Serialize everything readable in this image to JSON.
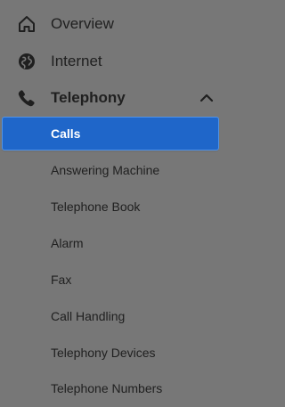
{
  "nav": {
    "top_items": [
      {
        "label": "Overview",
        "icon": "home-icon"
      },
      {
        "label": "Internet",
        "icon": "globe-icon"
      },
      {
        "label": "Telephony",
        "icon": "phone-icon",
        "expanded": true
      }
    ],
    "telephony_submenu": [
      {
        "label": "Calls",
        "active": true
      },
      {
        "label": "Answering Machine"
      },
      {
        "label": "Telephone Book"
      },
      {
        "label": "Alarm"
      },
      {
        "label": "Fax"
      },
      {
        "label": "Call Handling"
      },
      {
        "label": "Telephony Devices"
      },
      {
        "label": "Telephone Numbers"
      }
    ]
  },
  "colors": {
    "background": "#777777",
    "active_item": "#1f66c9",
    "text": "#202020",
    "active_text": "#ffffff"
  }
}
